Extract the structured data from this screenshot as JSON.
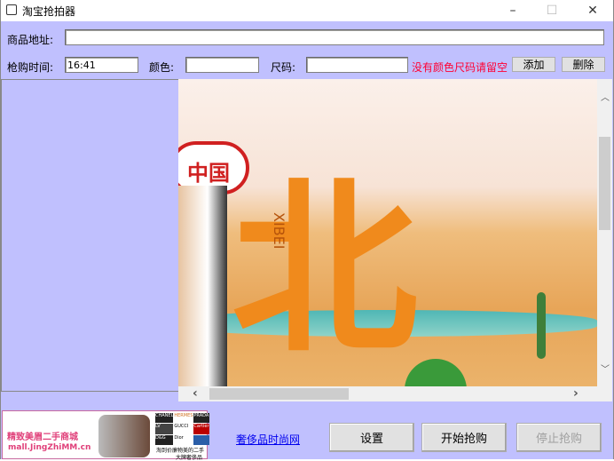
{
  "window": {
    "title": "淘宝抢拍器",
    "minimize": "–",
    "maximize": "☐",
    "close": "✕"
  },
  "form": {
    "url_label": "商品地址:",
    "url_value": "",
    "time_label": "枪购时间:",
    "time_value": "16:41",
    "color_label": "颜色:",
    "color_value": "",
    "size_label": "尺码:",
    "size_value": "",
    "hint": "没有颜色尺码请留空",
    "hint_color": "#ff0000",
    "add_label": "添加",
    "delete_label": "删除"
  },
  "browser": {
    "banner_text_cn": "中国",
    "banner_xibei": "XIBEI",
    "banner_big": "北",
    "vscroll_pos": 0.2,
    "hscroll_pos": 0.1
  },
  "ad": {
    "title": "精致美眉二手商城",
    "url": "mall.JingZhiMM.cn",
    "brands": [
      "CHANEL",
      "HERMES",
      "PRADA",
      "LV",
      "GUCCI",
      "Cartier",
      "D&G",
      "Dior",
      ""
    ],
    "slogan1": "淘到价廉物美的二手",
    "slogan2": "大牌奢侈品"
  },
  "footer": {
    "link": "奢侈品时尚网",
    "settings": "设置",
    "start": "开始抢购",
    "stop": "停止抢购"
  }
}
